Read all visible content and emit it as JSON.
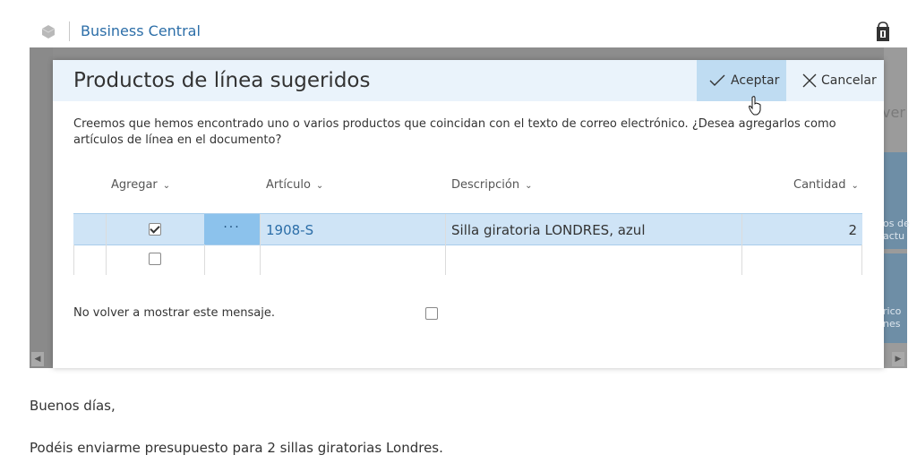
{
  "header": {
    "app_title": "Business Central",
    "logo_icon": "business-central-logo-icon",
    "office_icon": "office-icon"
  },
  "dialog": {
    "title": "Productos de línea sugeridos",
    "accept_label": "Aceptar",
    "cancel_label": "Cancelar",
    "message": "Creemos que hemos encontrado uno o varios productos que coincidan con el texto de correo electrónico. ¿Desea agregarlos como artículos de línea en el documento?",
    "columns": {
      "add": "Agregar",
      "item": "Artículo",
      "description": "Descripción",
      "quantity": "Cantidad"
    },
    "rows": [
      {
        "checked": true,
        "item": "1908-S",
        "description": "Silla giratoria LONDRES, azul",
        "quantity": "2",
        "ellipsis": "···"
      },
      {
        "checked": false,
        "item": "",
        "description": "",
        "quantity": ""
      }
    ],
    "dont_show_label": "No volver a mostrar este mensaje.",
    "dont_show_checked": false
  },
  "background": {
    "partial_text_1": "ver",
    "partial_text_2a": "os de",
    "partial_text_2b": "actu",
    "partial_text_3a": "rico",
    "partial_text_3b": "nes"
  },
  "email": {
    "greeting": "Buenos días,",
    "body": "Podéis enviarme presupuesto para 2 sillas giratorias Londres."
  },
  "colors": {
    "accent": "#2c6ea8",
    "header_bg": "#eaf3fb",
    "accept_bg": "#bfdcf2",
    "selected_row": "#cfe4f6"
  }
}
